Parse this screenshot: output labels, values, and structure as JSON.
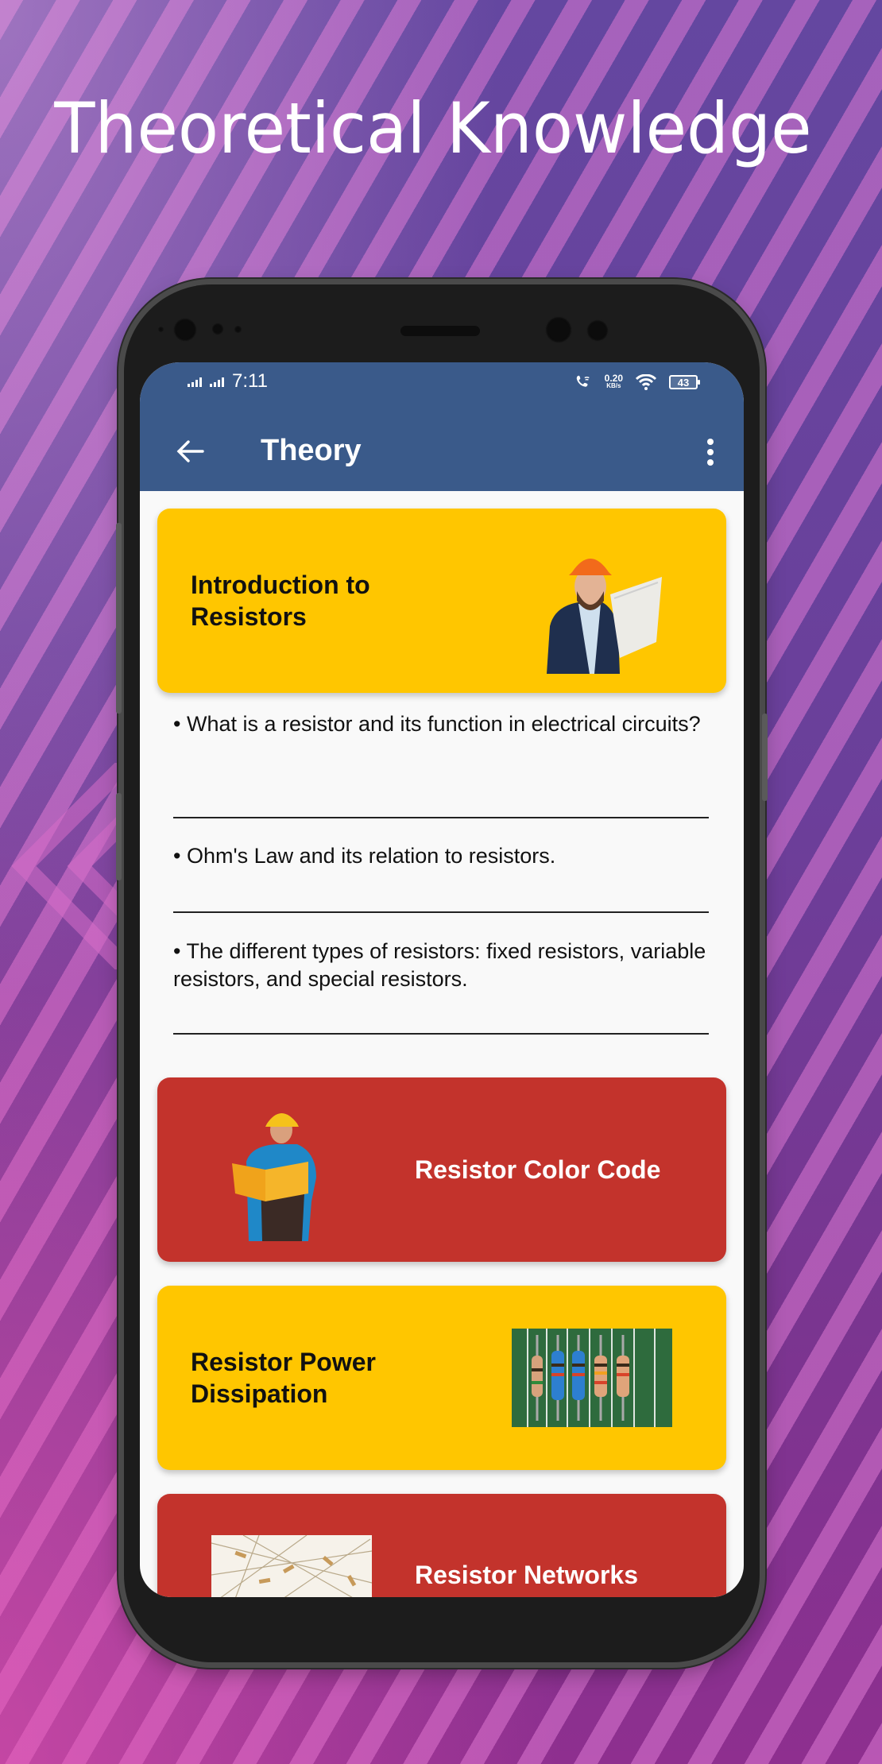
{
  "promo": {
    "headline": "Theoretical Knowledge"
  },
  "status_bar": {
    "time": "7:11",
    "network_speed_value": "0.20",
    "network_speed_unit": "KB/s",
    "battery": "43",
    "icons": [
      "signal-icon",
      "signal-icon",
      "wifi-calling-icon",
      "wifi-icon",
      "battery-icon"
    ]
  },
  "app_bar": {
    "title": "Theory",
    "back_icon": "arrow-left-icon",
    "menu_icon": "more-vertical-icon",
    "color": "#3a5a8a"
  },
  "sections": [
    {
      "title": "Introduction to Resistors",
      "title_line1": "Introduction to",
      "title_line2": "Resistors",
      "color": "#ffc600",
      "image": "engineer-with-blueprints",
      "expanded": true,
      "topics": [
        "• What is a resistor and its function in electrical circuits?",
        "• Ohm's Law and its relation to resistors.",
        "• The different types of resistors: fixed resistors, variable resistors, and special resistors."
      ]
    },
    {
      "title": "Resistor Color Code",
      "color": "#c3332c",
      "image": "worker-reading-folder",
      "expanded": false
    },
    {
      "title": "Resistor Power Dissipation",
      "title_line1": "Resistor Power",
      "title_line2": "Dissipation",
      "color": "#ffc600",
      "image": "resistors-on-circuit-board",
      "expanded": false
    },
    {
      "title": "Resistor Networks",
      "color": "#c3332c",
      "image": "resistor-pile",
      "expanded": false
    }
  ]
}
